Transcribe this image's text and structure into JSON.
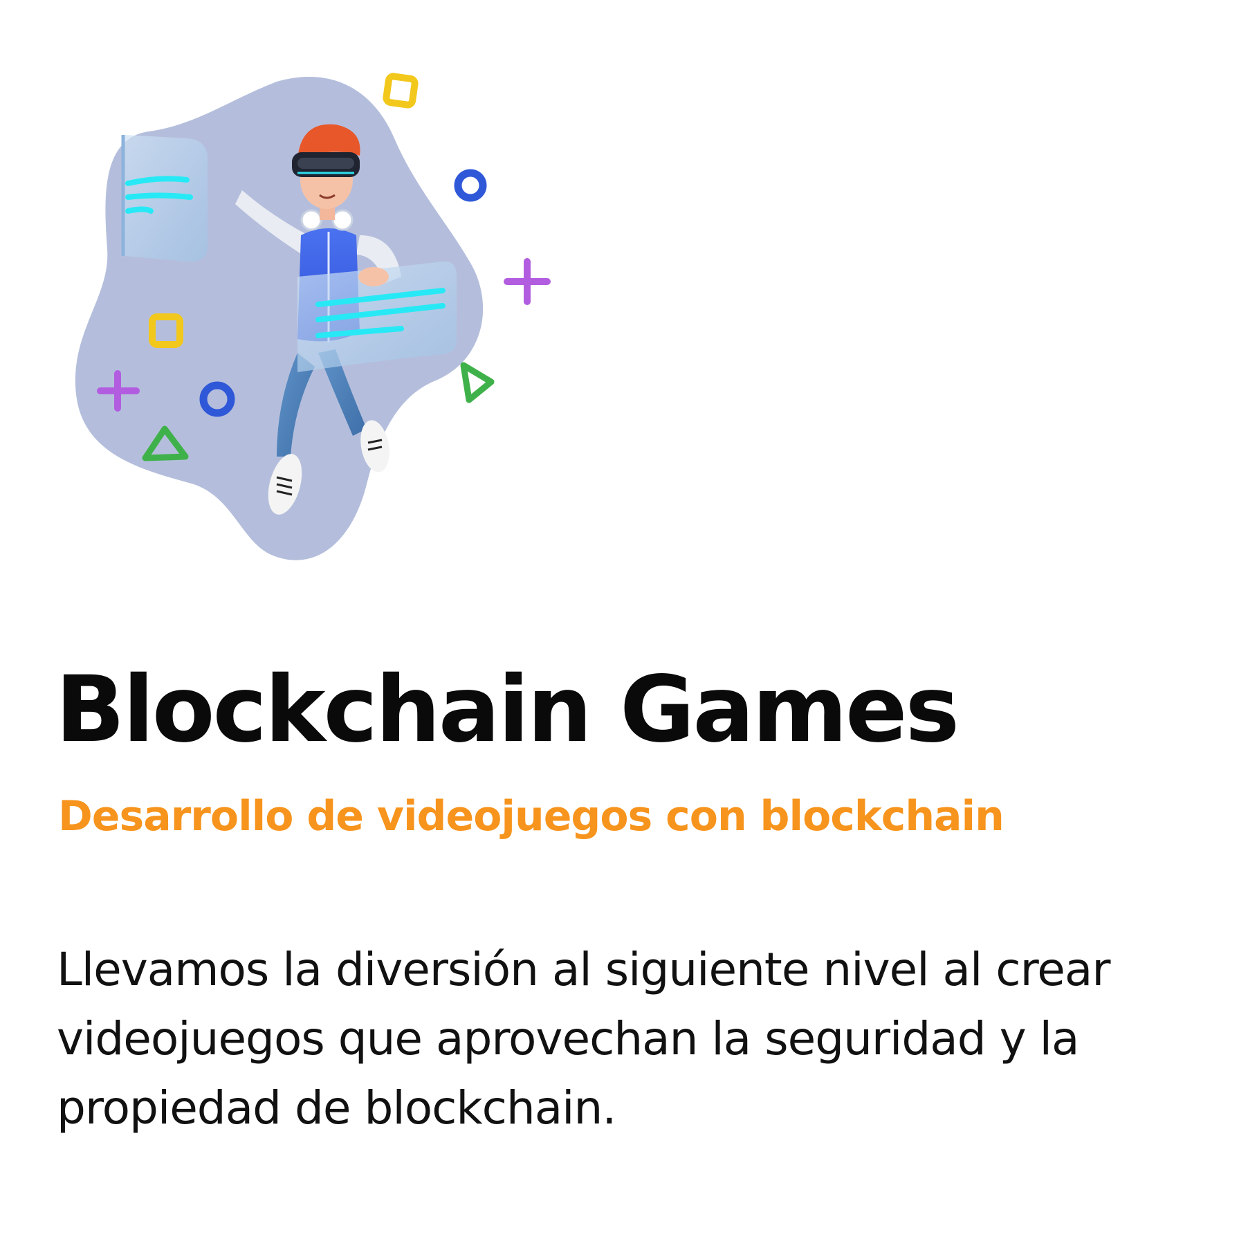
{
  "hero": {
    "illustration_icon": "vr-gamer-floating-with-holographic-screens-illustration"
  },
  "heading": {
    "title": "Blockchain Games",
    "subtitle": "Desarrollo de videojuegos con blockchain"
  },
  "description": {
    "lines": [
      "Llevamos la diversión al siguiente nivel al crear",
      "videojuegos que aprovechan la seguridad y la",
      "propiedad de blockchain."
    ]
  },
  "colors": {
    "background": "#ffffff",
    "title": "#0a0a0a",
    "accent": "#f7941d",
    "body": "#111111",
    "blob": "#b4bedc"
  }
}
